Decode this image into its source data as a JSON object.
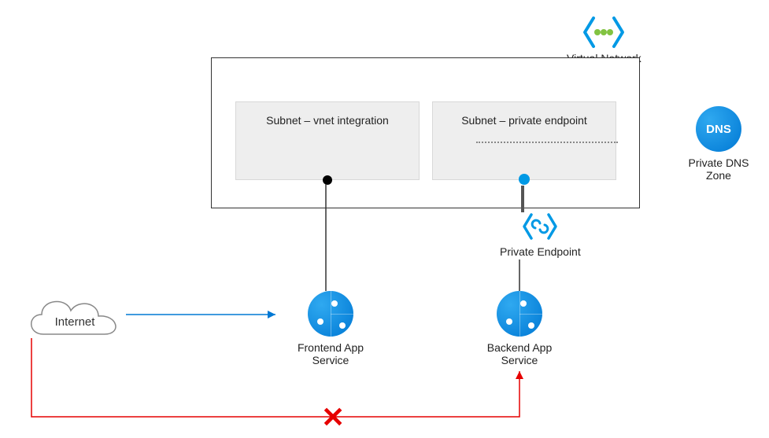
{
  "vnet": {
    "label": "Virtual Network",
    "subnet_integration": "Subnet – vnet integration",
    "subnet_private": "Subnet – private endpoint"
  },
  "private_endpoint": {
    "label": "Private Endpoint"
  },
  "dns": {
    "label": "Private DNS Zone",
    "badge": "DNS"
  },
  "frontend": {
    "label": "Frontend App Service"
  },
  "backend": {
    "label": "Backend App Service"
  },
  "internet": {
    "label": "Internet"
  },
  "connections": {
    "internet_to_frontend": {
      "allowed": true
    },
    "internet_to_backend": {
      "allowed": false
    }
  }
}
